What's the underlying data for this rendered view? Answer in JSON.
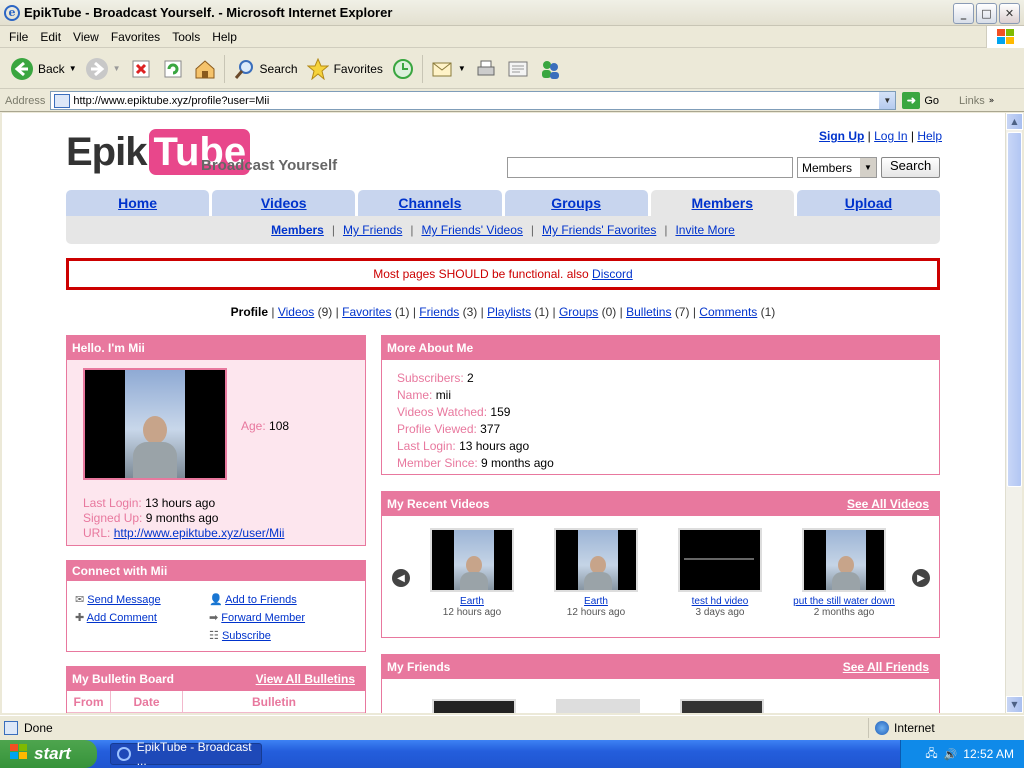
{
  "window": {
    "title": "EpikTube - Broadcast Yourself. - Microsoft Internet Explorer",
    "min": "_",
    "max": "□",
    "close": "✕"
  },
  "menu": [
    "File",
    "Edit",
    "View",
    "Favorites",
    "Tools",
    "Help"
  ],
  "toolbar": {
    "back": "Back",
    "search": "Search",
    "favorites": "Favorites"
  },
  "address": {
    "label": "Address",
    "url": "http://www.epiktube.xyz/profile?user=Mii",
    "go": "Go",
    "links": "Links"
  },
  "site": {
    "logo_epik": "Epik",
    "logo_tube": "Tube",
    "tagline": "Broadcast Yourself",
    "toplinks": {
      "signup": "Sign Up",
      "login": "Log In",
      "help": "Help",
      "sep": "|"
    },
    "search": {
      "select": "Members",
      "button": "Search"
    },
    "tabs": [
      "Home",
      "Videos",
      "Channels",
      "Groups",
      "Members",
      "Upload"
    ],
    "subnav": [
      "Members",
      "My Friends",
      "My Friends' Videos",
      "My Friends' Favorites",
      "Invite More"
    ],
    "notice": "Most pages SHOULD be functional. also ",
    "notice_link": "Discord",
    "profnav": {
      "profile": "Profile",
      "videos": "Videos",
      "videos_n": "(9)",
      "favorites": "Favorites",
      "favorites_n": "(1)",
      "friends": "Friends",
      "friends_n": "(3)",
      "playlists": "Playlists",
      "playlists_n": "(1)",
      "groups": "Groups",
      "groups_n": "(0)",
      "bulletins": "Bulletins",
      "bulletins_n": "(7)",
      "comments": "Comments",
      "comments_n": "(1)"
    }
  },
  "hello": {
    "title": "Hello. I'm Mii",
    "age_label": "Age:",
    "age": "108",
    "last_login_label": "Last Login:",
    "last_login": "13 hours ago",
    "signed_up_label": "Signed Up:",
    "signed_up": "9 months ago",
    "url_label": "URL:",
    "url": "http://www.epiktube.xyz/user/Mii"
  },
  "connect": {
    "title": "Connect with Mii",
    "send": "Send Message",
    "add_comment": "Add Comment",
    "add_friends": "Add to Friends",
    "forward": "Forward Member",
    "subscribe": "Subscribe"
  },
  "bulletin": {
    "title": "My Bulletin Board",
    "view_all": "View All Bulletins",
    "cols": [
      "From",
      "Date",
      "Bulletin"
    ]
  },
  "about": {
    "title": "More About Me",
    "rows": [
      {
        "label": "Subscribers:",
        "value": "2"
      },
      {
        "label": "Name:",
        "value": "mii"
      },
      {
        "label": "Videos Watched:",
        "value": "159"
      },
      {
        "label": "Profile Viewed:",
        "value": "377"
      },
      {
        "label": "Last Login:",
        "value": "13 hours ago"
      },
      {
        "label": "Member Since:",
        "value": "9 months ago"
      }
    ]
  },
  "recent": {
    "title": "My Recent Videos",
    "see_all": "See All Videos",
    "videos": [
      {
        "title": "Earth",
        "age": "12 hours ago"
      },
      {
        "title": "Earth",
        "age": "12 hours ago"
      },
      {
        "title": "test hd video",
        "age": "3 days ago"
      },
      {
        "title": "put the still water down",
        "age": "2 months ago"
      }
    ]
  },
  "friends": {
    "title": "My Friends",
    "see_all": "See All Friends"
  },
  "status": {
    "done": "Done",
    "zone": "Internet"
  },
  "taskbar": {
    "start": "start",
    "task": "EpikTube - Broadcast ...",
    "clock": "12:52 AM"
  }
}
